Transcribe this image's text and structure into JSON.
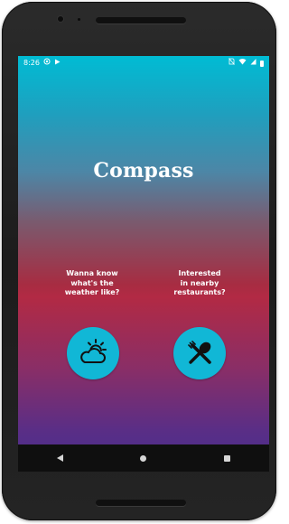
{
  "status_bar": {
    "time": "8:26",
    "left_icons": [
      "sync-icon",
      "play-store-icon"
    ],
    "right_icons": [
      "no-sim-icon",
      "wifi-icon",
      "signal-icon",
      "battery-icon"
    ]
  },
  "app": {
    "title": "Compass"
  },
  "options": [
    {
      "prompt": "Wanna know\nwhat's the\nweather like?",
      "icon": "weather-icon"
    },
    {
      "prompt": "Interested\nin nearby\nrestaurants?",
      "icon": "restaurant-icon"
    }
  ],
  "navigation": {
    "buttons": [
      "back-icon",
      "home-icon",
      "recent-apps-icon"
    ]
  },
  "colors": {
    "gradient_top": "#00bcd4",
    "gradient_middle": "#b22a44",
    "gradient_bottom": "#472d8e",
    "button": "#11b7d6",
    "icon": "#111111",
    "text": "#ffffff"
  }
}
